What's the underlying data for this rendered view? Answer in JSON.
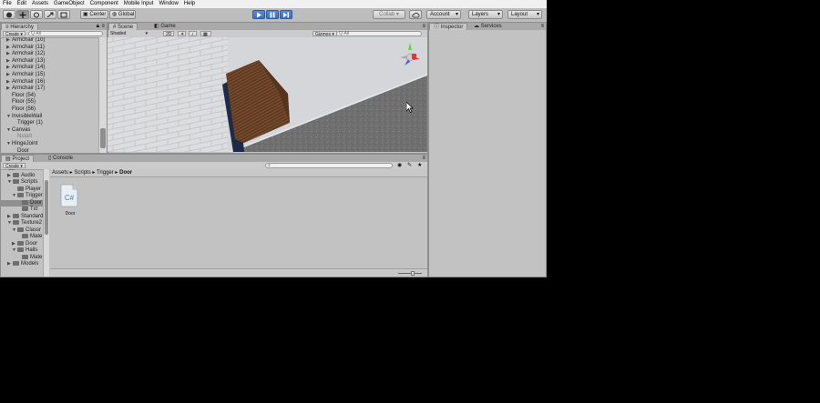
{
  "menu": [
    "File",
    "Edit",
    "Assets",
    "GameObject",
    "Component",
    "Mobile Input",
    "Window",
    "Help"
  ],
  "toolbar": {
    "pivot_label": "Center",
    "space_label": "Global",
    "collab_label": "Collab ▾",
    "account_label": "Account",
    "layers_label": "Layers",
    "layout_label": "Layout"
  },
  "hierarchy": {
    "tab": "Hierarchy",
    "create": "Create ▾",
    "search_label": "Q·All",
    "items": [
      {
        "label": "Armchair (10)",
        "fold": "▶",
        "indent": 1
      },
      {
        "label": "Armchair (11)",
        "fold": "▶",
        "indent": 1
      },
      {
        "label": "Armchair (12)",
        "fold": "▶",
        "indent": 1
      },
      {
        "label": "Armchair (13)",
        "fold": "▶",
        "indent": 1
      },
      {
        "label": "Armchair (14)",
        "fold": "▶",
        "indent": 1
      },
      {
        "label": "Armchair (15)",
        "fold": "▶",
        "indent": 1
      },
      {
        "label": "Armchair (16)",
        "fold": "▶",
        "indent": 1
      },
      {
        "label": "Armchair (17)",
        "fold": "▶",
        "indent": 1
      },
      {
        "label": "Floor (54)",
        "fold": "",
        "indent": 1
      },
      {
        "label": "Floor (55)",
        "fold": "",
        "indent": 1
      },
      {
        "label": "Floor (56)",
        "fold": "",
        "indent": 1
      },
      {
        "label": "InvisibleWall",
        "fold": "▼",
        "indent": 1
      },
      {
        "label": "Trigger (1)",
        "fold": "",
        "indent": 2
      },
      {
        "label": "Canvas",
        "fold": "▼",
        "indent": 1
      },
      {
        "label": "Nstart",
        "fold": "",
        "indent": 2,
        "dim": true
      },
      {
        "label": "HingeJoint",
        "fold": "▼",
        "indent": 1
      },
      {
        "label": "Door",
        "fold": "",
        "indent": 2
      }
    ]
  },
  "scene": {
    "tab_scene": "Scene",
    "tab_game": "Game",
    "shading": "Shaded",
    "mode_2d": "2D",
    "gizmos": "Gizmos ▾",
    "search": "Q·All"
  },
  "inspector": {
    "tab_inspector": "Inspector",
    "tab_services": "Services"
  },
  "project": {
    "tab_project": "Project",
    "tab_console": "Console",
    "create": "Create ▾",
    "breadcrumb": [
      "Assets",
      "Scripts",
      "Trigger",
      "Door"
    ],
    "tree": [
      {
        "label": "Assets",
        "indent": 0,
        "fold": "▼"
      },
      {
        "label": "Audio",
        "indent": 1,
        "fold": "▶"
      },
      {
        "label": "Scripts",
        "indent": 1,
        "fold": "▼"
      },
      {
        "label": "Player",
        "indent": 2,
        "fold": ""
      },
      {
        "label": "Trigger",
        "indent": 2,
        "fold": "▼"
      },
      {
        "label": "Door",
        "indent": 3,
        "fold": "",
        "selected": true
      },
      {
        "label": "Txt",
        "indent": 3,
        "fold": ""
      },
      {
        "label": "Standard",
        "indent": 1,
        "fold": "▶"
      },
      {
        "label": "Texture2",
        "indent": 1,
        "fold": "▼"
      },
      {
        "label": "Classr",
        "indent": 2,
        "fold": "▼"
      },
      {
        "label": "Mate",
        "indent": 3,
        "fold": ""
      },
      {
        "label": "Door",
        "indent": 2,
        "fold": "▶"
      },
      {
        "label": "Halls",
        "indent": 2,
        "fold": "▼"
      },
      {
        "label": "Mate",
        "indent": 3,
        "fold": ""
      },
      {
        "label": "Models",
        "indent": 1,
        "fold": "▶"
      }
    ],
    "asset_name": "Door",
    "asset_icon_text": "C#"
  }
}
